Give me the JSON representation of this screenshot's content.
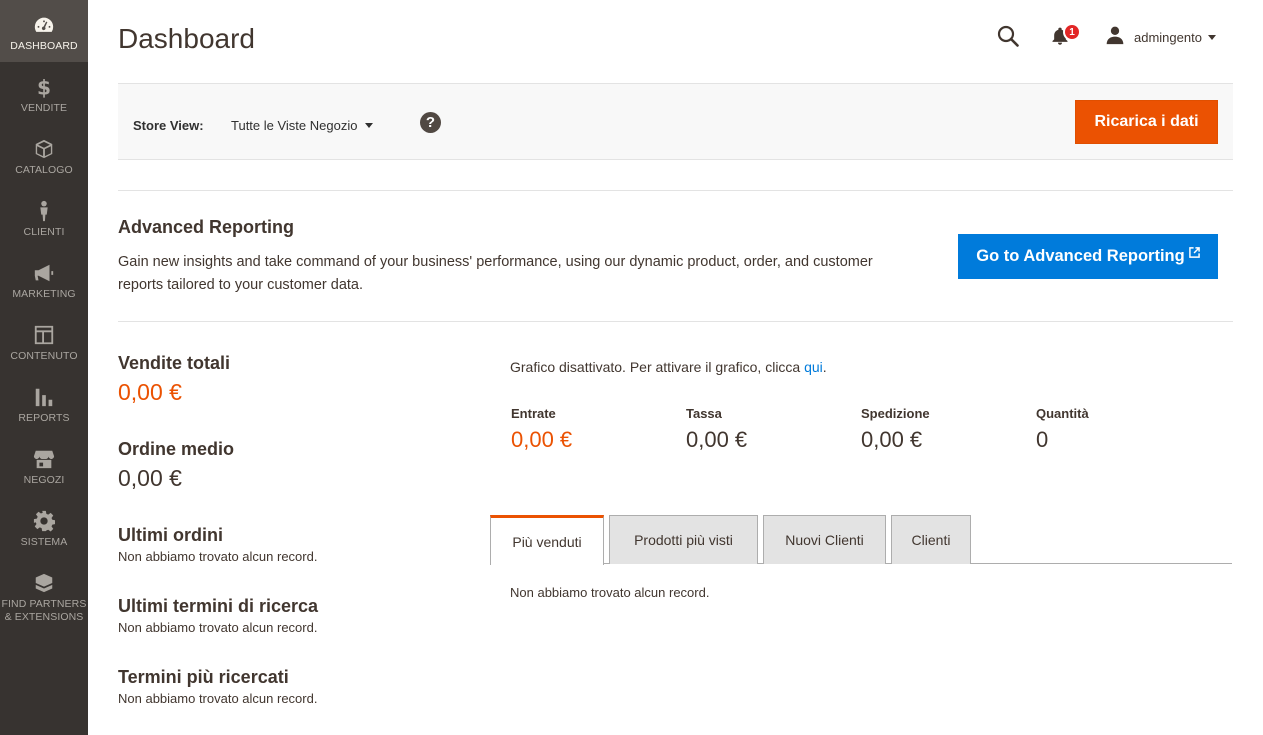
{
  "sidebar": {
    "items": [
      {
        "label": "DASHBOARD",
        "icon": "dashboard-icon"
      },
      {
        "label": "VENDITE",
        "icon": "dollar-icon"
      },
      {
        "label": "CATALOGO",
        "icon": "box-icon"
      },
      {
        "label": "CLIENTI",
        "icon": "person-icon"
      },
      {
        "label": "MARKETING",
        "icon": "megaphone-icon"
      },
      {
        "label": "CONTENUTO",
        "icon": "layout-icon"
      },
      {
        "label": "REPORTS",
        "icon": "bar-chart-icon"
      },
      {
        "label": "NEGOZI",
        "icon": "store-icon"
      },
      {
        "label": "SISTEMA",
        "icon": "gear-icon"
      },
      {
        "label": "FIND PARTNERS",
        "label2": "& EXTENSIONS",
        "icon": "blocks-icon"
      }
    ]
  },
  "header": {
    "title": "Dashboard",
    "notification_count": "1",
    "username": "admingento"
  },
  "store_bar": {
    "label": "Store View:",
    "selected": "Tutte le Viste Negozio",
    "help": "?",
    "reload_label": "Ricarica i dati"
  },
  "advanced_reporting": {
    "title": "Advanced Reporting",
    "text": "Gain new insights and take command of your business' performance, using our dynamic product, order, and customer reports tailored to your customer data.",
    "button_label": "Go to Advanced Reporting"
  },
  "stats": {
    "total_sales_label": "Vendite totali",
    "total_sales_value": "0,00 €",
    "avg_order_label": "Ordine medio",
    "avg_order_value": "0,00 €",
    "last_orders_label": "Ultimi ordini",
    "last_search_label": "Ultimi termini di ricerca",
    "top_search_label": "Termini più ricercati",
    "no_records": "Non abbiamo trovato alcun record."
  },
  "chart": {
    "message": "Grafico disattivato. Per attivare il grafico, clicca ",
    "link": "qui",
    "suffix": ".",
    "totals": [
      {
        "label": "Entrate",
        "value": "0,00 €"
      },
      {
        "label": "Tassa",
        "value": "0,00 €"
      },
      {
        "label": "Spedizione",
        "value": "0,00 €"
      },
      {
        "label": "Quantità",
        "value": "0"
      }
    ]
  },
  "tabs": {
    "items": [
      "Più venduti",
      "Prodotti più visti",
      "Nuovi Clienti",
      "Clienti"
    ],
    "active": "Più venduti",
    "content": "Non abbiamo trovato alcun record."
  },
  "colors": {
    "accent": "#eb5202",
    "link": "#007bdb",
    "sidebar": "#373330"
  }
}
